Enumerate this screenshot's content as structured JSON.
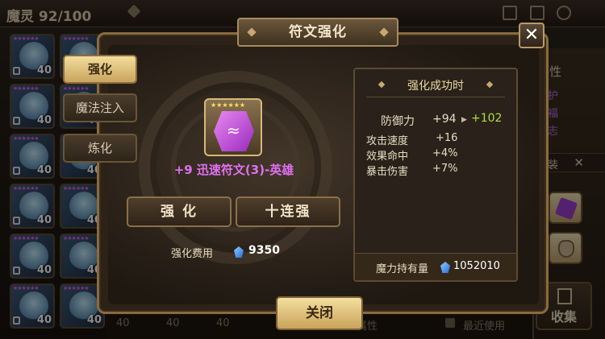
{
  "topbar": {
    "monster_label": "魔灵 92/100"
  },
  "monster_list": {
    "levels": [
      "40",
      "40",
      "40",
      "40",
      "40",
      "40",
      "40",
      "40",
      "40",
      "40",
      "40",
      "40"
    ],
    "bottom_levels": [
      "40",
      "40",
      "40"
    ],
    "stars": "★★★★★★"
  },
  "right_panel": {
    "title": "属性",
    "lines": [
      "守护",
      "祝福",
      "意志"
    ],
    "sub_label": "套装",
    "collect_label": "收集"
  },
  "bottom_filters": {
    "attribute": "属性",
    "recent": "最近使用"
  },
  "modal": {
    "title": "符文强化",
    "close_icon": "close-icon",
    "tabs": [
      {
        "label": "强化",
        "active": true
      },
      {
        "label": "魔法注入",
        "active": false
      },
      {
        "label": "炼化",
        "active": false
      }
    ],
    "rune": {
      "stars": "★★★★★★",
      "name": "+9 迅速符文(3)-英雄"
    },
    "buttons": {
      "enhance": "强 化",
      "ten_enhance": "十连强"
    },
    "cost": {
      "label": "强化费用",
      "value": "9350"
    },
    "result": {
      "title": "强化成功时",
      "main_stat": {
        "label": "防御力",
        "current": "+94",
        "next": "+102"
      },
      "sub_stats": [
        {
          "label": "攻击速度",
          "value": "+16"
        },
        {
          "label": "效果命中",
          "value": "+4%"
        },
        {
          "label": "暴击伤害",
          "value": "+7%"
        }
      ],
      "mana": {
        "label": "魔力持有量",
        "value": "1052010"
      }
    },
    "close_button": "关闭"
  },
  "colors": {
    "accent_gold": "#c9a55e",
    "rune_name": "#e070f0",
    "upgrade_green": "#a8e040"
  }
}
